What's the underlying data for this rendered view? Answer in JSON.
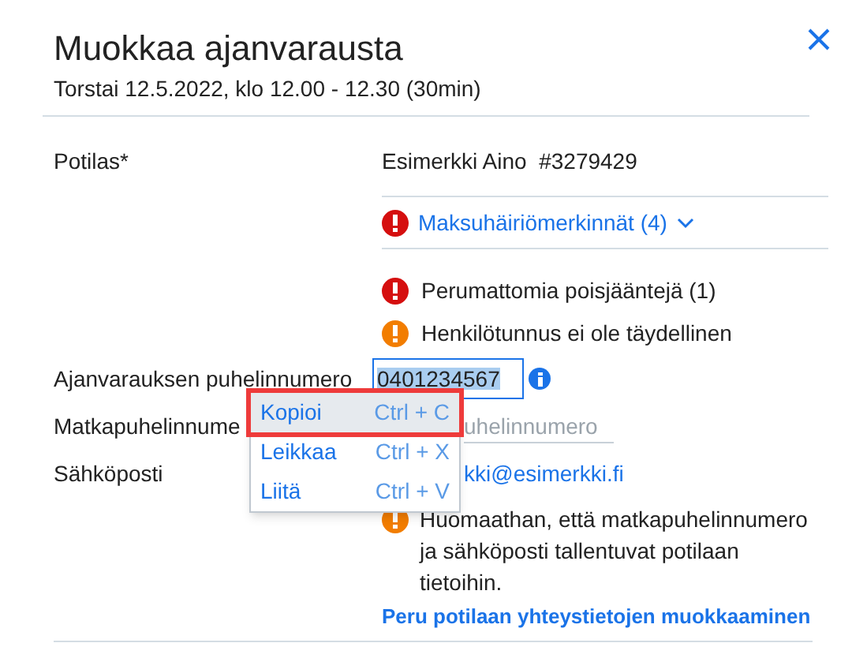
{
  "header": {
    "title": "Muokkaa ajanvarausta",
    "subtitle": "Torstai 12.5.2022, klo 12.00 - 12.30 (30min)"
  },
  "patient": {
    "label": "Potilas*",
    "name": "Esimerkki Aino  #3279429",
    "link": "Maksuhäiriömerkinnät (4)",
    "expanded": false
  },
  "alerts": [
    {
      "color": "#d50f0f",
      "text": "Perumattomia poisjääntejä (1)"
    },
    {
      "color": "#f27d00",
      "text": "Henkilötunnus ei ole täydellinen"
    }
  ],
  "fields": [
    {
      "label": "Ajanvarauksen puhelinnumero",
      "value": "0401234567",
      "selected": true
    },
    {
      "label": "Matkapuhelinnume",
      "placeholder": "uhelinnumero"
    },
    {
      "label": "Sähköposti",
      "value": "kki@esimerkki.fi"
    }
  ],
  "notice": {
    "color": "#f27d00",
    "text": "Huomaathan, että matkapuhelinnumero ja sähköposti tallentuvat potilaan tietoihin."
  },
  "cancel_link": "Peru potilaan yhteystietojen muokkaaminen",
  "context_menu": [
    {
      "label": "Kopioi",
      "shortcut": "Ctrl + C",
      "selected": true
    },
    {
      "label": "Leikkaa",
      "shortcut": "Ctrl + X",
      "selected": false
    },
    {
      "label": "Liitä",
      "shortcut": "Ctrl + V",
      "selected": false
    }
  ]
}
